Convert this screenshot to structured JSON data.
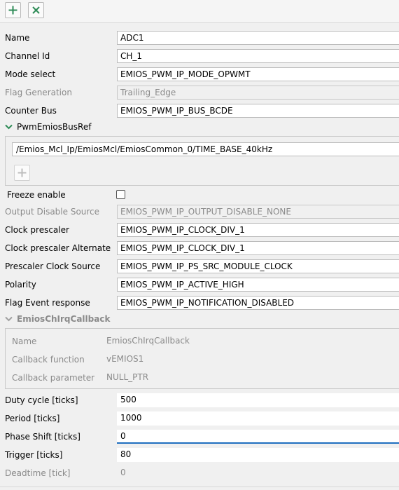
{
  "toolbar": {
    "add_icon": "plus-icon",
    "remove_icon": "close-icon"
  },
  "fields": {
    "name": {
      "label": "Name",
      "value": "ADC1"
    },
    "channel_id": {
      "label": "Channel Id",
      "value": "CH_1"
    },
    "mode_select": {
      "label": "Mode select",
      "value": "EMIOS_PWM_IP_MODE_OPWMT"
    },
    "flag_generation": {
      "label": "Flag Generation",
      "value": "Trailing_Edge"
    },
    "counter_bus": {
      "label": "Counter Bus",
      "value": "EMIOS_PWM_IP_BUS_BCDE"
    }
  },
  "bus_ref": {
    "title": "PwmEmiosBusRef",
    "value": "/Emios_Mcl_Ip/EmiosMcl/EmiosCommon_0/TIME_BASE_40kHz"
  },
  "fields2": {
    "freeze_enable": {
      "label": "Freeze enable"
    },
    "output_disable_source": {
      "label": "Output Disable Source",
      "value": "EMIOS_PWM_IP_OUTPUT_DISABLE_NONE"
    },
    "clock_prescaler": {
      "label": "Clock prescaler",
      "value": "EMIOS_PWM_IP_CLOCK_DIV_1"
    },
    "clock_prescaler_alt": {
      "label": "Clock prescaler Alternate",
      "value": "EMIOS_PWM_IP_CLOCK_DIV_1"
    },
    "prescaler_clock_source": {
      "label": "Prescaler Clock Source",
      "value": "EMIOS_PWM_IP_PS_SRC_MODULE_CLOCK"
    },
    "polarity": {
      "label": "Polarity",
      "value": "EMIOS_PWM_IP_ACTIVE_HIGH"
    },
    "flag_event_response": {
      "label": "Flag Event response",
      "value": "EMIOS_PWM_IP_NOTIFICATION_DISABLED"
    }
  },
  "callback": {
    "title": "EmiosChIrqCallback",
    "name": {
      "label": "Name",
      "value": "EmiosChIrqCallback"
    },
    "function": {
      "label": "Callback function",
      "value": "vEMIOS1"
    },
    "parameter": {
      "label": "Callback parameter",
      "value": "NULL_PTR"
    }
  },
  "ticks": {
    "duty_cycle": {
      "label": "Duty cycle [ticks]",
      "value": "500"
    },
    "period": {
      "label": "Period [ticks]",
      "value": "1000"
    },
    "phase_shift": {
      "label": "Phase Shift [ticks]",
      "value": "0"
    },
    "trigger": {
      "label": "Trigger [ticks]",
      "value": "80"
    },
    "deadtime": {
      "label": "Deadtime [tick]",
      "value": "0"
    }
  }
}
